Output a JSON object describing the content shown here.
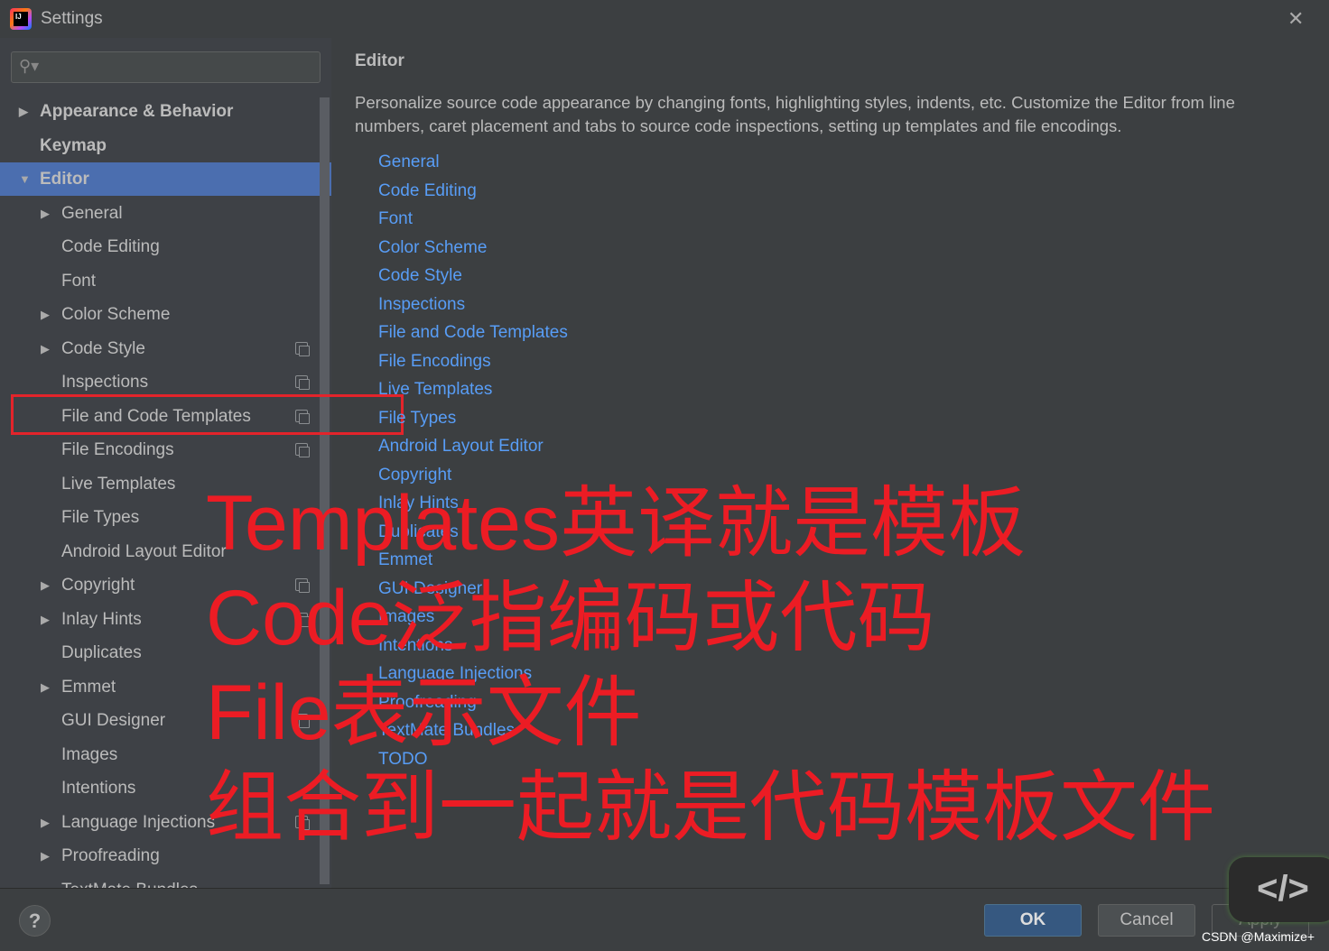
{
  "window": {
    "title": "Settings",
    "icon": "intellij-logo-icon",
    "close_icon": "close-icon"
  },
  "search": {
    "value": "",
    "placeholder": ""
  },
  "sidebar": {
    "items": [
      {
        "label": "Appearance & Behavior",
        "level": 0,
        "arrow": "right",
        "bold": true
      },
      {
        "label": "Keymap",
        "level": 0,
        "bold": true
      },
      {
        "label": "Editor",
        "level": 0,
        "arrow": "down",
        "bold": true,
        "selected": true
      },
      {
        "label": "General",
        "level": 1,
        "arrow": "right"
      },
      {
        "label": "Code Editing",
        "level": 1
      },
      {
        "label": "Font",
        "level": 1
      },
      {
        "label": "Color Scheme",
        "level": 1,
        "arrow": "right"
      },
      {
        "label": "Code Style",
        "level": 1,
        "arrow": "right",
        "project": true
      },
      {
        "label": "Inspections",
        "level": 1,
        "project": true
      },
      {
        "label": "File and Code Templates",
        "level": 1,
        "project": true,
        "highlighted": true
      },
      {
        "label": "File Encodings",
        "level": 1,
        "project": true
      },
      {
        "label": "Live Templates",
        "level": 1
      },
      {
        "label": "File Types",
        "level": 1
      },
      {
        "label": "Android Layout Editor",
        "level": 1
      },
      {
        "label": "Copyright",
        "level": 1,
        "arrow": "right",
        "project": true
      },
      {
        "label": "Inlay Hints",
        "level": 1,
        "arrow": "right",
        "project": true
      },
      {
        "label": "Duplicates",
        "level": 1
      },
      {
        "label": "Emmet",
        "level": 1,
        "arrow": "right"
      },
      {
        "label": "GUI Designer",
        "level": 1,
        "project": true
      },
      {
        "label": "Images",
        "level": 1
      },
      {
        "label": "Intentions",
        "level": 1
      },
      {
        "label": "Language Injections",
        "level": 1,
        "arrow": "right",
        "project": true
      },
      {
        "label": "Proofreading",
        "level": 1,
        "arrow": "right"
      },
      {
        "label": "TextMate Bundles",
        "level": 1
      }
    ]
  },
  "main": {
    "title": "Editor",
    "description": "Personalize source code appearance by changing fonts, highlighting styles, indents, etc. Customize the Editor from line numbers, caret placement and tabs to source code inspections, setting up templates and file encodings.",
    "links": [
      "General",
      "Code Editing",
      "Font",
      "Color Scheme",
      "Code Style",
      "Inspections",
      "File and Code Templates",
      "File Encodings",
      "Live Templates",
      "File Types",
      "Android Layout Editor",
      "Copyright",
      "Inlay Hints",
      "Duplicates",
      "Emmet",
      "GUI Designer",
      "Images",
      "Intentions",
      "Language Injections",
      "Proofreading",
      "TextMate Bundles",
      "TODO"
    ]
  },
  "overlay": {
    "lines": [
      "Templates英译就是模板",
      "Code泛指编码或代码",
      "File表示文件",
      "组合到一起就是代码模板文件"
    ],
    "color": "#ec1c24"
  },
  "footer": {
    "help": "?",
    "ok": "OK",
    "cancel": "Cancel",
    "apply": "Apply"
  },
  "badge": {
    "text": "</>"
  },
  "watermark": "CSDN @Maximize+",
  "colors": {
    "selection": "#4b6eaf",
    "link": "#589df6",
    "background": "#3c3f41"
  }
}
